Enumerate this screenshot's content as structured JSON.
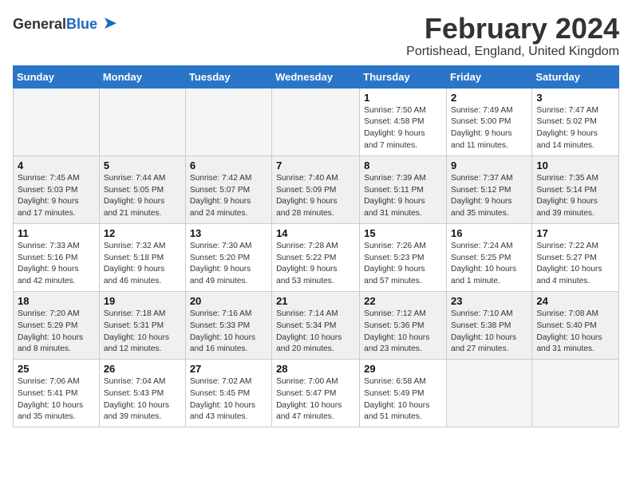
{
  "logo": {
    "general": "General",
    "blue": "Blue"
  },
  "title": "February 2024",
  "location": "Portishead, England, United Kingdom",
  "days_of_week": [
    "Sunday",
    "Monday",
    "Tuesday",
    "Wednesday",
    "Thursday",
    "Friday",
    "Saturday"
  ],
  "weeks": [
    [
      {
        "day": "",
        "info": ""
      },
      {
        "day": "",
        "info": ""
      },
      {
        "day": "",
        "info": ""
      },
      {
        "day": "",
        "info": ""
      },
      {
        "day": "1",
        "info": "Sunrise: 7:50 AM\nSunset: 4:58 PM\nDaylight: 9 hours\nand 7 minutes."
      },
      {
        "day": "2",
        "info": "Sunrise: 7:49 AM\nSunset: 5:00 PM\nDaylight: 9 hours\nand 11 minutes."
      },
      {
        "day": "3",
        "info": "Sunrise: 7:47 AM\nSunset: 5:02 PM\nDaylight: 9 hours\nand 14 minutes."
      }
    ],
    [
      {
        "day": "4",
        "info": "Sunrise: 7:45 AM\nSunset: 5:03 PM\nDaylight: 9 hours\nand 17 minutes."
      },
      {
        "day": "5",
        "info": "Sunrise: 7:44 AM\nSunset: 5:05 PM\nDaylight: 9 hours\nand 21 minutes."
      },
      {
        "day": "6",
        "info": "Sunrise: 7:42 AM\nSunset: 5:07 PM\nDaylight: 9 hours\nand 24 minutes."
      },
      {
        "day": "7",
        "info": "Sunrise: 7:40 AM\nSunset: 5:09 PM\nDaylight: 9 hours\nand 28 minutes."
      },
      {
        "day": "8",
        "info": "Sunrise: 7:39 AM\nSunset: 5:11 PM\nDaylight: 9 hours\nand 31 minutes."
      },
      {
        "day": "9",
        "info": "Sunrise: 7:37 AM\nSunset: 5:12 PM\nDaylight: 9 hours\nand 35 minutes."
      },
      {
        "day": "10",
        "info": "Sunrise: 7:35 AM\nSunset: 5:14 PM\nDaylight: 9 hours\nand 39 minutes."
      }
    ],
    [
      {
        "day": "11",
        "info": "Sunrise: 7:33 AM\nSunset: 5:16 PM\nDaylight: 9 hours\nand 42 minutes."
      },
      {
        "day": "12",
        "info": "Sunrise: 7:32 AM\nSunset: 5:18 PM\nDaylight: 9 hours\nand 46 minutes."
      },
      {
        "day": "13",
        "info": "Sunrise: 7:30 AM\nSunset: 5:20 PM\nDaylight: 9 hours\nand 49 minutes."
      },
      {
        "day": "14",
        "info": "Sunrise: 7:28 AM\nSunset: 5:22 PM\nDaylight: 9 hours\nand 53 minutes."
      },
      {
        "day": "15",
        "info": "Sunrise: 7:26 AM\nSunset: 5:23 PM\nDaylight: 9 hours\nand 57 minutes."
      },
      {
        "day": "16",
        "info": "Sunrise: 7:24 AM\nSunset: 5:25 PM\nDaylight: 10 hours\nand 1 minute."
      },
      {
        "day": "17",
        "info": "Sunrise: 7:22 AM\nSunset: 5:27 PM\nDaylight: 10 hours\nand 4 minutes."
      }
    ],
    [
      {
        "day": "18",
        "info": "Sunrise: 7:20 AM\nSunset: 5:29 PM\nDaylight: 10 hours\nand 8 minutes."
      },
      {
        "day": "19",
        "info": "Sunrise: 7:18 AM\nSunset: 5:31 PM\nDaylight: 10 hours\nand 12 minutes."
      },
      {
        "day": "20",
        "info": "Sunrise: 7:16 AM\nSunset: 5:33 PM\nDaylight: 10 hours\nand 16 minutes."
      },
      {
        "day": "21",
        "info": "Sunrise: 7:14 AM\nSunset: 5:34 PM\nDaylight: 10 hours\nand 20 minutes."
      },
      {
        "day": "22",
        "info": "Sunrise: 7:12 AM\nSunset: 5:36 PM\nDaylight: 10 hours\nand 23 minutes."
      },
      {
        "day": "23",
        "info": "Sunrise: 7:10 AM\nSunset: 5:38 PM\nDaylight: 10 hours\nand 27 minutes."
      },
      {
        "day": "24",
        "info": "Sunrise: 7:08 AM\nSunset: 5:40 PM\nDaylight: 10 hours\nand 31 minutes."
      }
    ],
    [
      {
        "day": "25",
        "info": "Sunrise: 7:06 AM\nSunset: 5:41 PM\nDaylight: 10 hours\nand 35 minutes."
      },
      {
        "day": "26",
        "info": "Sunrise: 7:04 AM\nSunset: 5:43 PM\nDaylight: 10 hours\nand 39 minutes."
      },
      {
        "day": "27",
        "info": "Sunrise: 7:02 AM\nSunset: 5:45 PM\nDaylight: 10 hours\nand 43 minutes."
      },
      {
        "day": "28",
        "info": "Sunrise: 7:00 AM\nSunset: 5:47 PM\nDaylight: 10 hours\nand 47 minutes."
      },
      {
        "day": "29",
        "info": "Sunrise: 6:58 AM\nSunset: 5:49 PM\nDaylight: 10 hours\nand 51 minutes."
      },
      {
        "day": "",
        "info": ""
      },
      {
        "day": "",
        "info": ""
      }
    ]
  ]
}
